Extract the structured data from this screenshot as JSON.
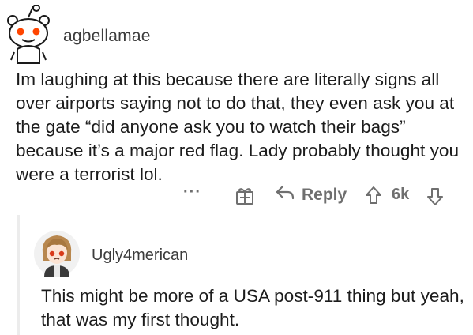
{
  "comments": [
    {
      "username": "agbellamae",
      "body": "Im laughing at this because there are literally signs all over airports saying not to do that, they even ask you at the gate “did anyone ask you to watch their bags” because it’s a major red flag. Lady probably thought you were a terrorist lol.",
      "avatar": "snoo-avatar-icon",
      "actions": {
        "more_label": "···",
        "award_icon": "award-gift-icon",
        "reply_label": "Reply",
        "score": "6k"
      }
    },
    {
      "username": "Ugly4merican",
      "body": "This might be more of a USA post-911 thing but yeah, that was my first thought.",
      "avatar": "custom-avatar-icon"
    }
  ],
  "colors": {
    "text": "#1c1c1c",
    "meta": "#6f6f6f",
    "thread_line": "#ececec"
  }
}
